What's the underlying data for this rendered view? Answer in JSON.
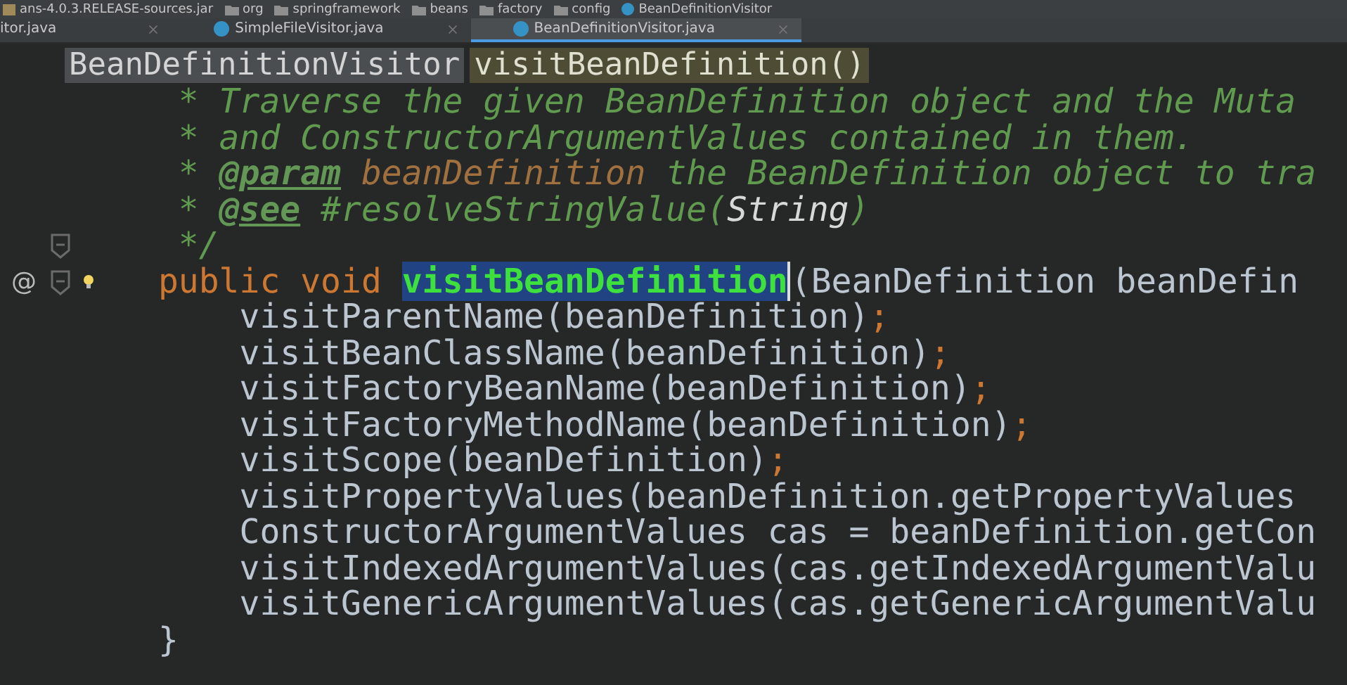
{
  "breadcrumbs": [
    {
      "label": "ans-4.0.3.RELEASE-sources.jar",
      "kind": "jar"
    },
    {
      "label": "org",
      "kind": "folder"
    },
    {
      "label": "springframework",
      "kind": "folder"
    },
    {
      "label": "beans",
      "kind": "folder"
    },
    {
      "label": "factory",
      "kind": "folder"
    },
    {
      "label": "config",
      "kind": "folder"
    },
    {
      "label": "BeanDefinitionVisitor",
      "kind": "class"
    }
  ],
  "tabs": [
    {
      "label": "itor.java",
      "selected": false,
      "icon": false
    },
    {
      "label": "SimpleFileVisitor.java",
      "selected": false,
      "icon": true
    },
    {
      "label": "BeanDefinitionVisitor.java",
      "selected": true,
      "icon": true
    }
  ],
  "sticky_header": {
    "class": "BeanDefinitionVisitor",
    "method": "visitBeanDefinition()"
  },
  "lines": [
    {
      "fold": false,
      "bulb": false,
      "tokens": [
        {
          "kind": "comment",
          "text": "  * Traverse the given BeanDefinition object and the Muta"
        }
      ]
    },
    {
      "fold": false,
      "bulb": false,
      "tokens": [
        {
          "kind": "comment",
          "text": "  * and ConstructorArgumentValues contained in them."
        }
      ]
    },
    {
      "fold": false,
      "bulb": false,
      "tokens": [
        {
          "kind": "comment",
          "text": "  * "
        },
        {
          "kind": "doctag",
          "text": "@param"
        },
        {
          "kind": "param",
          "text": " beanDefinition"
        },
        {
          "kind": "comment",
          "text": " the BeanDefinition object to tra"
        }
      ]
    },
    {
      "fold": false,
      "bulb": false,
      "tokens": [
        {
          "kind": "comment",
          "text": "  * "
        },
        {
          "kind": "doctag",
          "text": "@see"
        },
        {
          "kind": "comment",
          "text": " #resolveStringValue("
        },
        {
          "kind": "docref",
          "text": "String"
        },
        {
          "kind": "comment",
          "text": ")"
        }
      ]
    },
    {
      "fold": true,
      "bulb": false,
      "tokens": [
        {
          "kind": "comment",
          "text": "  */"
        }
      ]
    },
    {
      "annotation": "@",
      "fold": true,
      "bulb": true,
      "tokens": [
        {
          "kind": "keyword",
          "text": " public void "
        },
        {
          "kind": "selected",
          "text": "visitBeanDefinition"
        },
        {
          "kind": "plain",
          "text": "(BeanDefinition beanDefin"
        }
      ]
    },
    {
      "fold": false,
      "bulb": false,
      "tokens": [
        {
          "kind": "plain",
          "text": "     visitParentName(beanDefinition)"
        },
        {
          "kind": "keyword",
          "text": ";"
        }
      ]
    },
    {
      "fold": false,
      "bulb": false,
      "tokens": [
        {
          "kind": "plain",
          "text": "     visitBeanClassName(beanDefinition)"
        },
        {
          "kind": "keyword",
          "text": ";"
        }
      ]
    },
    {
      "fold": false,
      "bulb": false,
      "tokens": [
        {
          "kind": "plain",
          "text": "     visitFactoryBeanName(beanDefinition)"
        },
        {
          "kind": "keyword",
          "text": ";"
        }
      ]
    },
    {
      "fold": false,
      "bulb": false,
      "tokens": [
        {
          "kind": "plain",
          "text": "     visitFactoryMethodName(beanDefinition)"
        },
        {
          "kind": "keyword",
          "text": ";"
        }
      ]
    },
    {
      "fold": false,
      "bulb": false,
      "tokens": [
        {
          "kind": "plain",
          "text": "     visitScope(beanDefinition)"
        },
        {
          "kind": "keyword",
          "text": ";"
        }
      ]
    },
    {
      "fold": false,
      "bulb": false,
      "tokens": [
        {
          "kind": "plain",
          "text": "     visitPropertyValues(beanDefinition.getPropertyValues"
        }
      ]
    },
    {
      "fold": false,
      "bulb": false,
      "tokens": [
        {
          "kind": "plain",
          "text": "     ConstructorArgumentValues cas = beanDefinition.getCon"
        }
      ]
    },
    {
      "fold": false,
      "bulb": false,
      "tokens": [
        {
          "kind": "plain",
          "text": "     visitIndexedArgumentValues(cas.getIndexedArgumentValu"
        }
      ]
    },
    {
      "fold": false,
      "bulb": false,
      "tokens": [
        {
          "kind": "plain",
          "text": "     visitGenericArgumentValues(cas.getGenericArgumentValu"
        }
      ]
    },
    {
      "fold": false,
      "bulb": false,
      "tokens": [
        {
          "kind": "plain",
          "text": " }"
        }
      ]
    }
  ]
}
